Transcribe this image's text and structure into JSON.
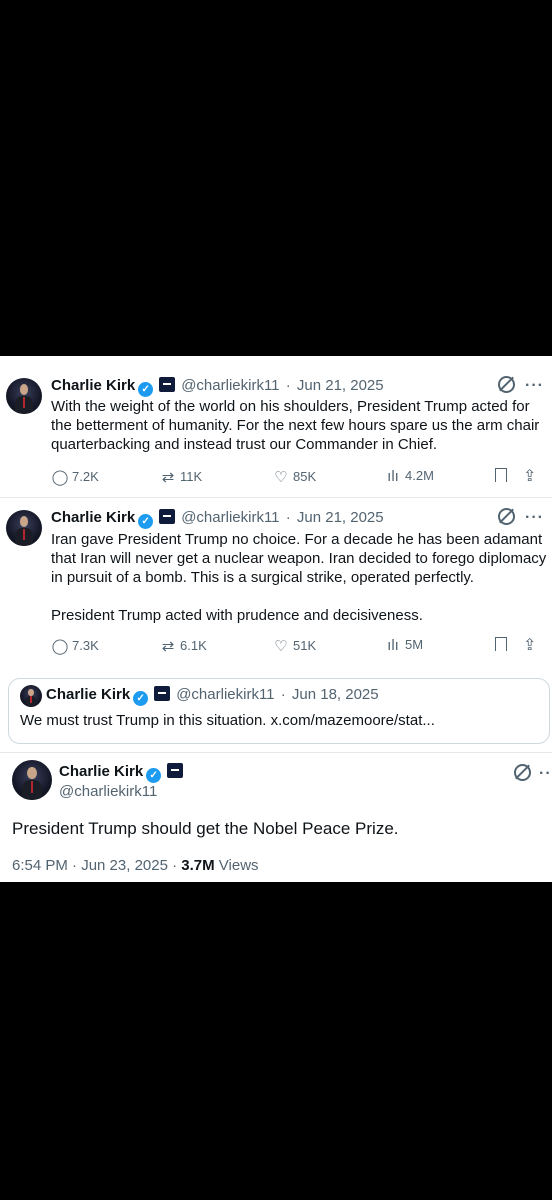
{
  "tweets": [
    {
      "name": "Charlie Kirk",
      "handle": "@charliekirk11",
      "sep": "·",
      "date": "Jun 21, 2025",
      "text_lines": [
        "With the weight of the world on his shoulders, President Trump acted for",
        "the betterment of humanity. For the next few hours spare us the arm chair",
        "quarterbacking and instead trust our Commander in Chief."
      ],
      "replies": "7.2K",
      "reposts": "11K",
      "likes": "85K",
      "views": "4.2M"
    },
    {
      "name": "Charlie Kirk",
      "handle": "@charliekirk11",
      "sep": "·",
      "date": "Jun 21, 2025",
      "text_lines": [
        "Iran gave President Trump no choice. For a decade he has been adamant",
        "that Iran will never get a nuclear weapon. Iran decided to forego diplomacy",
        "in pursuit of a bomb. This is a surgical strike, operated perfectly."
      ],
      "text_line_extra": "President Trump acted with prudence and decisiveness.",
      "replies": "7.3K",
      "reposts": "6.1K",
      "likes": "51K",
      "views": "5M"
    }
  ],
  "quote": {
    "name": "Charlie Kirk",
    "handle": "@charliekirk11",
    "sep": "·",
    "date": "Jun 18, 2025",
    "text": "We must trust Trump in this situation. x.com/mazemoore/stat..."
  },
  "main": {
    "name": "Charlie Kirk",
    "handle": "@charliekirk11",
    "text": "President Trump should get the Nobel Peace Prize.",
    "time_date": "6:54 PM · Jun 23, 2025 · ",
    "views_count": "3.7M",
    "views_label": " Views"
  },
  "icons": {
    "verified": "verified-badge-icon",
    "affiliate": "organization-affiliate-icon",
    "grok": "grok-icon",
    "more": "more-icon",
    "reply": "reply-icon",
    "repost": "repost-icon",
    "like": "like-icon",
    "views": "views-icon",
    "bookmark": "bookmark-icon",
    "share": "share-icon"
  },
  "colors": {
    "background": "#000000",
    "card": "#ffffff",
    "text": "#0f1419",
    "secondary": "#536471",
    "verified": "#1d9bf0"
  }
}
